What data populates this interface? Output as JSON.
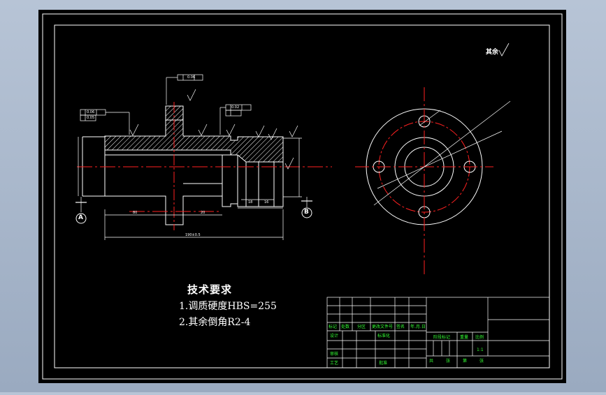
{
  "technical_requirements": {
    "title": "技术要求",
    "items": [
      "1.调质硬度HBS=255",
      "2.其余倒角R2-4"
    ]
  },
  "roughness_note": "其余",
  "datums": {
    "a": "A",
    "b": "B"
  },
  "title_block": {
    "row_labels": {
      "mark": "标记",
      "count": "处数",
      "zone": "分区",
      "doc_no": "更改文件号",
      "sign": "签名",
      "date": "年.月.日",
      "design": "设计",
      "standardize": "标准化",
      "review": "审核",
      "process": "工艺",
      "approve": "批准"
    },
    "stage_mark": "阶段标记",
    "weight": "重量",
    "scale": "比例",
    "scale_value": "1:1",
    "sheets_total": "共",
    "sheets_unit": "张",
    "sheet_no": "第",
    "sheet_unit": "张"
  },
  "dims": {
    "tol1": "0.06",
    "tol2": "0.06",
    "tol3": "0.02",
    "tol4": "0.05",
    "overall_length": "190±0.5",
    "len_a": "80",
    "len_b": "20",
    "len_c": "18",
    "len_d": "16"
  },
  "colors": {
    "background": "#000000",
    "outline": "#ffffff",
    "center_line": "#ff2020",
    "title_block_text": "#34ff34",
    "frame": "#b7c4d6"
  }
}
